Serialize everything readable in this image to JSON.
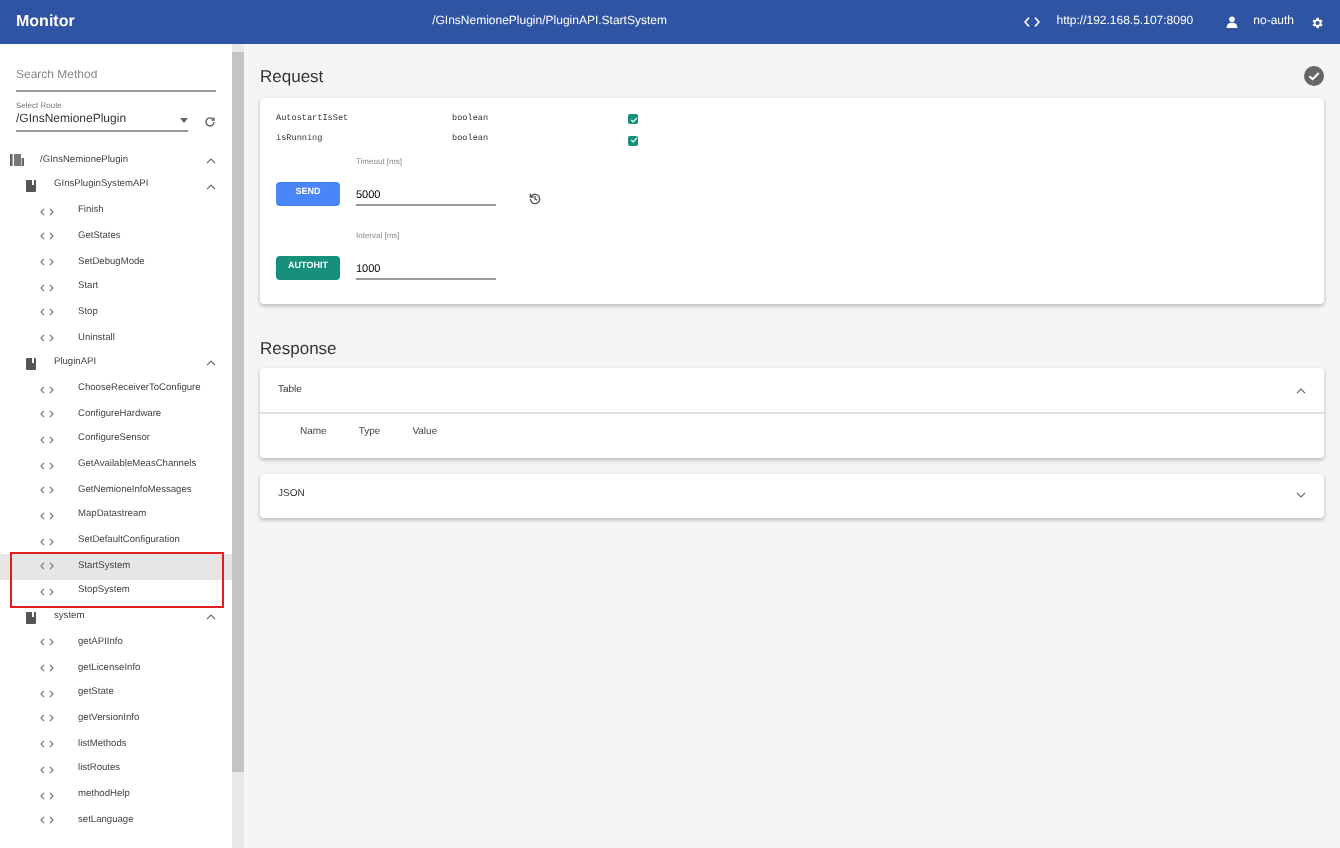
{
  "app_bar": {
    "title": "Monitor",
    "path": "/GInsNemionePlugin/PluginAPI.StartSystem",
    "server": "http://192.168.5.107:8090",
    "user": "no-auth"
  },
  "sidebar": {
    "search": {
      "placeholder": "Search Method"
    },
    "route": {
      "label": "Select Route",
      "value": "/GInsNemionePlugin"
    },
    "tree": [
      {
        "label": "/GInsNemionePlugin",
        "kind": "route",
        "expanded": true,
        "children": [
          {
            "label": "GInsPluginSystemAPI",
            "kind": "api",
            "expanded": true,
            "children": [
              {
                "label": "Finish",
                "kind": "method",
                "selected": false
              },
              {
                "label": "GetStates",
                "kind": "method",
                "selected": false
              },
              {
                "label": "SetDebugMode",
                "kind": "method",
                "selected": false
              },
              {
                "label": "Start",
                "kind": "method",
                "selected": false
              },
              {
                "label": "Stop",
                "kind": "method",
                "selected": false
              },
              {
                "label": "Uninstall",
                "kind": "method",
                "selected": false
              }
            ]
          },
          {
            "label": "PluginAPI",
            "kind": "api",
            "expanded": true,
            "children": [
              {
                "label": "ChooseReceiverToConfigure",
                "kind": "method",
                "selected": false
              },
              {
                "label": "ConfigureHardware",
                "kind": "method",
                "selected": false
              },
              {
                "label": "ConfigureSensor",
                "kind": "method",
                "selected": false
              },
              {
                "label": "GetAvailableMeasChannels",
                "kind": "method",
                "selected": false
              },
              {
                "label": "GetNemioneInfoMessages",
                "kind": "method",
                "selected": false
              },
              {
                "label": "MapDatastream",
                "kind": "method",
                "selected": false
              },
              {
                "label": "SetDefaultConfiguration",
                "kind": "method",
                "selected": false
              },
              {
                "label": "StartSystem",
                "kind": "method",
                "selected": true
              },
              {
                "label": "StopSystem",
                "kind": "method",
                "selected": false
              }
            ]
          },
          {
            "label": "system",
            "kind": "api",
            "expanded": true,
            "children": [
              {
                "label": "getAPIInfo",
                "kind": "method",
                "selected": false
              },
              {
                "label": "getLicenseInfo",
                "kind": "method",
                "selected": false
              },
              {
                "label": "getState",
                "kind": "method",
                "selected": false
              },
              {
                "label": "getVersionInfo",
                "kind": "method",
                "selected": false
              },
              {
                "label": "listMethods",
                "kind": "method",
                "selected": false
              },
              {
                "label": "listRoutes",
                "kind": "method",
                "selected": false
              },
              {
                "label": "methodHelp",
                "kind": "method",
                "selected": false
              },
              {
                "label": "setLanguage",
                "kind": "method",
                "selected": false
              }
            ]
          }
        ]
      }
    ]
  },
  "request": {
    "title": "Request",
    "params": [
      {
        "name": "AutostartIsSet",
        "type": "boolean",
        "checked": true
      },
      {
        "name": "isRunning",
        "type": "boolean",
        "checked": true
      }
    ],
    "send_button": "SEND",
    "timeout": {
      "label": "Timeout [ms]",
      "value": "5000"
    },
    "autohit_button": "AUTOHIT",
    "interval": {
      "label": "Interval [ms]",
      "value": "1000"
    }
  },
  "response": {
    "title": "Response",
    "panels": [
      {
        "title": "Table",
        "expanded": true,
        "columns": [
          "Name",
          "Type",
          "Value"
        ]
      },
      {
        "title": "JSON",
        "expanded": false
      }
    ]
  }
}
